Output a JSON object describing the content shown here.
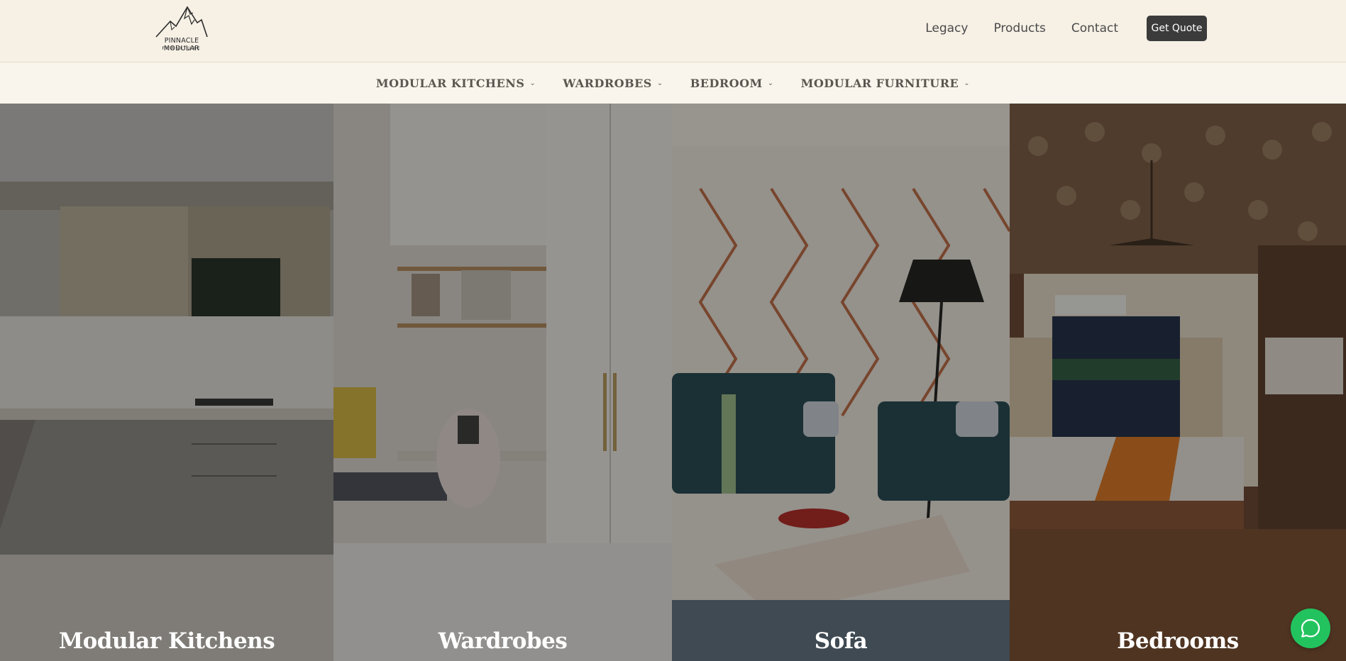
{
  "brand": {
    "name": "PINNACLE MODULAR",
    "tagline": "FURNITURE"
  },
  "topnav": {
    "links": [
      "Legacy",
      "Products",
      "Contact"
    ],
    "cta": "Get Quote"
  },
  "catnav": {
    "items": [
      {
        "label": "MODULAR KITCHENS"
      },
      {
        "label": "WARDROBES"
      },
      {
        "label": "BEDROOM"
      },
      {
        "label": "MODULAR FURNITURE"
      }
    ]
  },
  "panels": [
    {
      "title": "Modular Kitchens"
    },
    {
      "title": "Wardrobes"
    },
    {
      "title": "Sofa"
    },
    {
      "title": "Bedrooms"
    }
  ],
  "colors": {
    "header_bg": "#f6f0e5",
    "cta_bg": "#3b3b3b",
    "whatsapp": "#22c35e"
  },
  "icons": {
    "chevron": "chevron-down-icon",
    "whatsapp": "whatsapp-icon",
    "logo": "mountain-logo-icon"
  }
}
